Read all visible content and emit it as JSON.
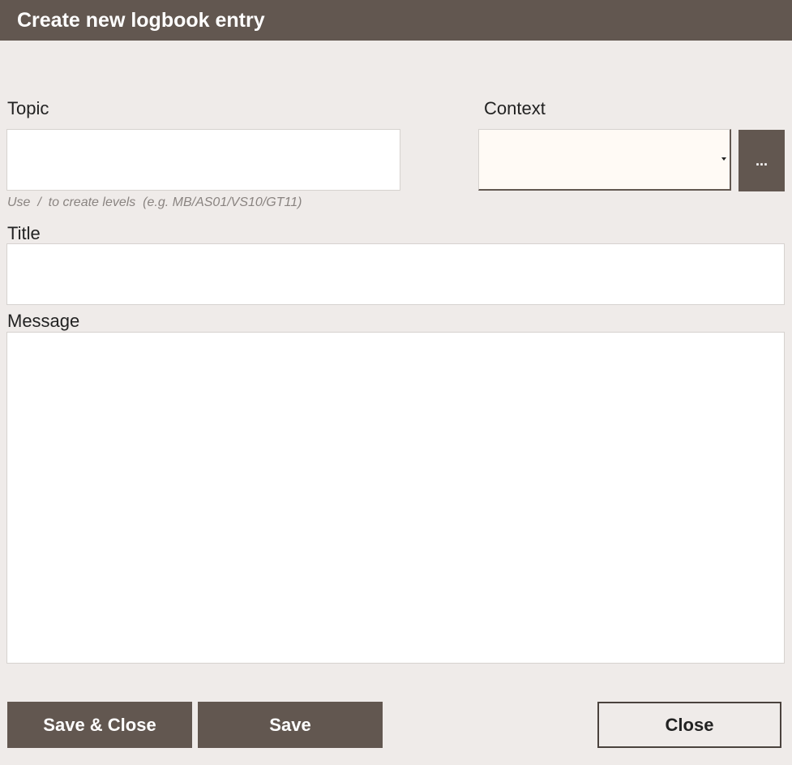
{
  "header": {
    "title": "Create new logbook entry"
  },
  "form": {
    "topic": {
      "label": "Topic",
      "value": "",
      "hint": "Use  /  to create levels  (e.g. MB/AS01/VS10/GT11)"
    },
    "context": {
      "label": "Context",
      "selected": "",
      "more_label": "..."
    },
    "title": {
      "label": "Title",
      "value": ""
    },
    "message": {
      "label": "Message",
      "value": ""
    }
  },
  "actions": {
    "save_close_label": "Save & Close",
    "save_label": "Save",
    "close_label": "Close"
  },
  "colors": {
    "header_bg": "#625750",
    "page_bg": "#efebe9",
    "button_dark": "#625750",
    "select_bg": "#fffaf5",
    "hint_text": "#8a8481"
  }
}
